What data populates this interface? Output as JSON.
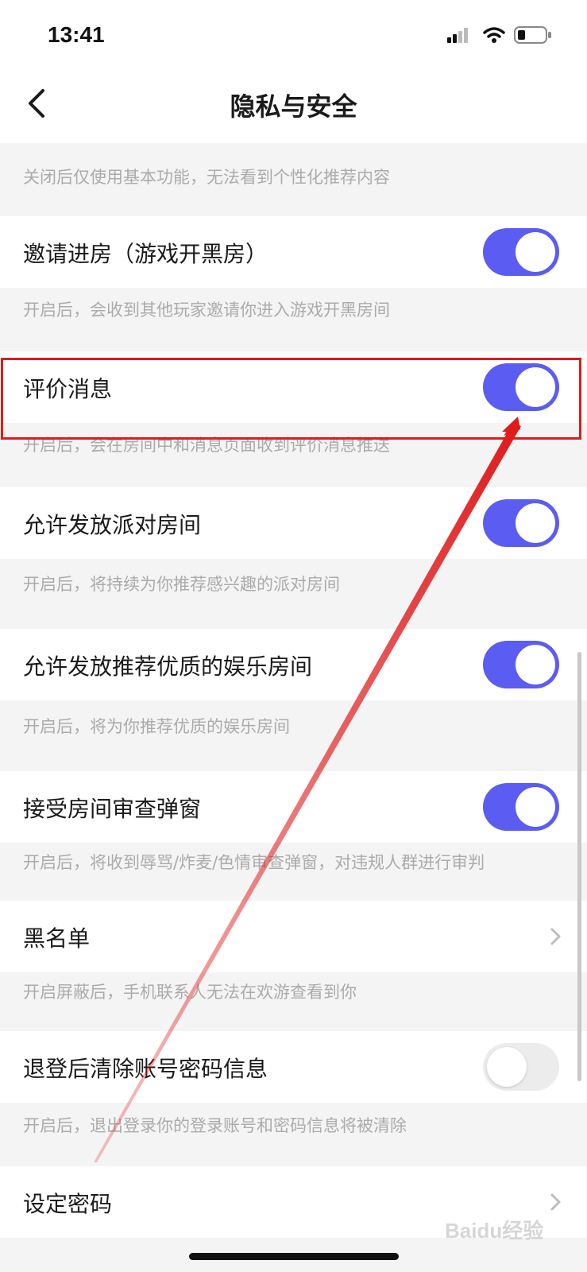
{
  "status_bar": {
    "time": "13:41"
  },
  "nav": {
    "title": "隐私与安全"
  },
  "top_partial": {
    "desc": "关闭后仅使用基本功能，无法看到个性化推荐内容",
    "enabled": true
  },
  "settings": [
    {
      "label": "邀请进房（游戏开黑房）",
      "desc": "开启后，会收到其他玩家邀请你进入游戏开黑房间",
      "control": "toggle",
      "enabled": true
    },
    {
      "label": "评价消息",
      "desc": "开启后，会在房间中和消息页面收到评价消息推送",
      "control": "toggle",
      "enabled": true,
      "highlighted": true
    },
    {
      "label": "允许发放派对房间",
      "desc": "开启后，将持续为你推荐感兴趣的派对房间",
      "control": "toggle",
      "enabled": true
    },
    {
      "label": "允许发放推荐优质的娱乐房间",
      "desc": "开启后，将为你推荐优质的娱乐房间",
      "control": "toggle",
      "enabled": true
    },
    {
      "label": "接受房间审查弹窗",
      "desc": "开启后，将收到辱骂/炸麦/色情审查弹窗，对违规人群进行审判",
      "control": "toggle",
      "enabled": true
    },
    {
      "label": "黑名单",
      "desc": "开启屏蔽后，手机联系人无法在欢游查看到你",
      "control": "chevron"
    },
    {
      "label": "退登后清除账号密码信息",
      "desc": "开启后，退出登录你的登录账号和密码信息将被清除",
      "control": "toggle",
      "enabled": false
    },
    {
      "label": "设定密码",
      "control": "chevron"
    }
  ],
  "watermark": "Baidu经验",
  "colors": {
    "toggle_on": "#5b5cf2",
    "toggle_off": "#ececec",
    "highlight": "#e01b1b",
    "background": "#f4f4f5"
  }
}
